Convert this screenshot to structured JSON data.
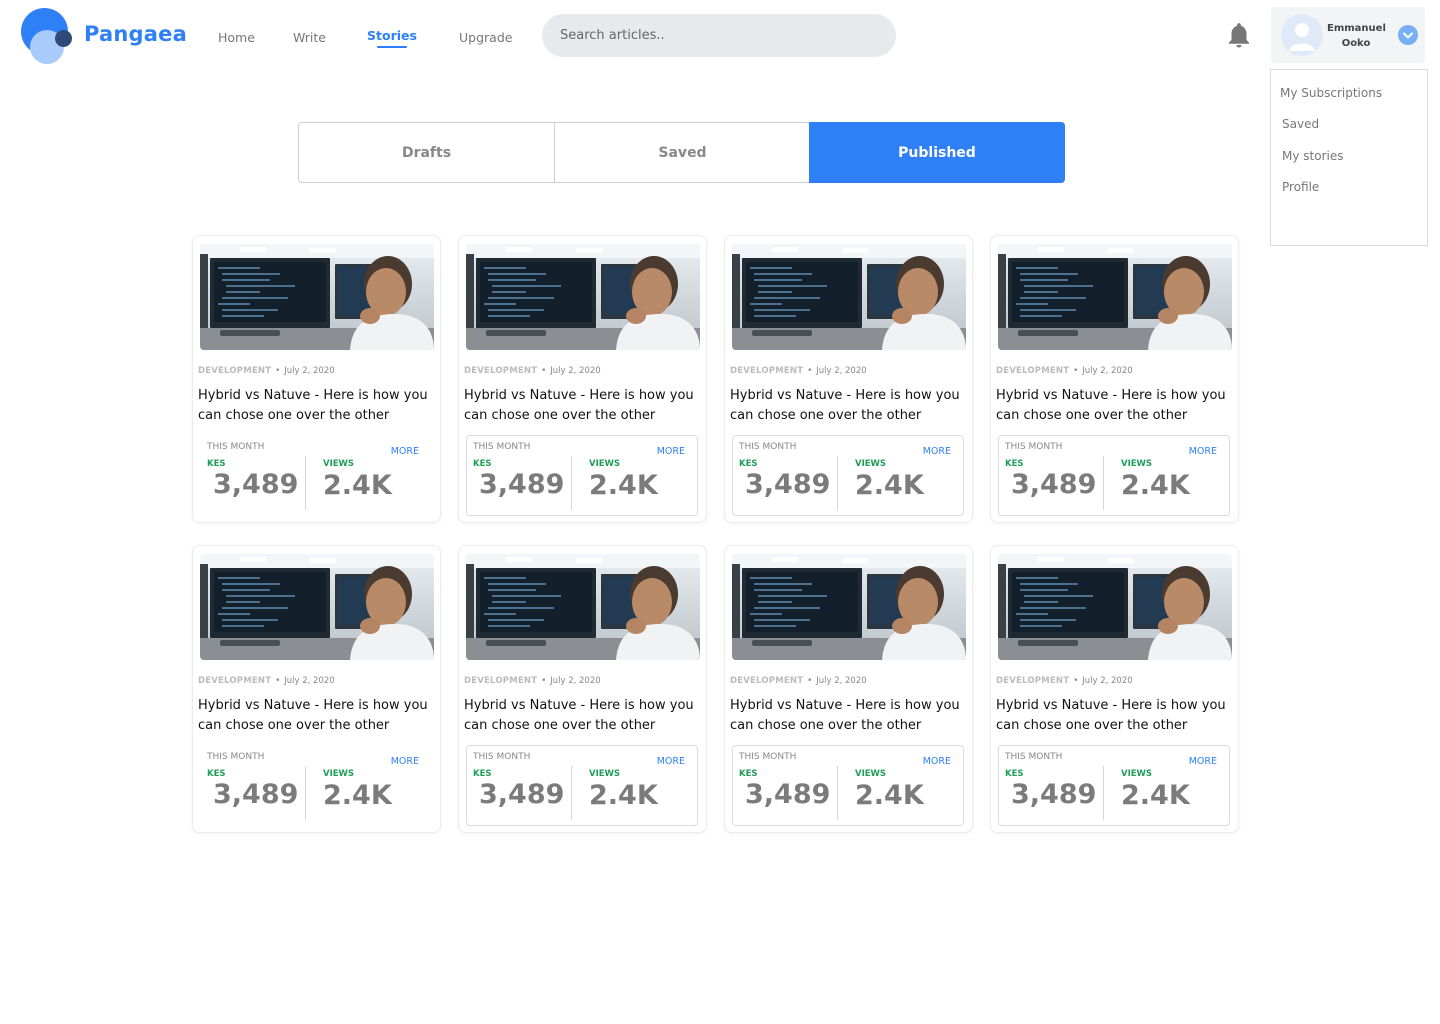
{
  "brand": {
    "name": "Pangaea"
  },
  "nav": [
    {
      "label": "Home"
    },
    {
      "label": "Write"
    },
    {
      "label": "Stories"
    },
    {
      "label": "Upgrade"
    }
  ],
  "search": {
    "placeholder": "Search articles.."
  },
  "user": {
    "first": "Emmanuel",
    "last": "Ooko"
  },
  "menu": [
    "My Subscriptions",
    "Saved",
    "My stories",
    "Profile"
  ],
  "tabs": [
    "Drafts",
    "Saved",
    "Published"
  ],
  "active_tab": "Published",
  "colors": {
    "accent": "#2f80f7",
    "positive": "#1e9e57"
  },
  "icons": {
    "notifications": "bell-icon",
    "dropdown": "chevron-down-icon",
    "avatar": "user-avatar-icon"
  },
  "cards": [
    {
      "category": "DEVELOPMENT",
      "date": "July 2, 2020",
      "title": "Hybrid vs Natuve - Here is how you can chose one over the other",
      "period": "THIS MONTH",
      "more": "MORE",
      "earnings_label": "KES",
      "earnings": "3,489",
      "views_label": "VIEWS",
      "views": "2.4K"
    },
    {
      "category": "DEVELOPMENT",
      "date": "July 2, 2020",
      "title": "Hybrid vs Natuve - Here is how you can chose one over the other",
      "period": "THIS MONTH",
      "more": "MORE",
      "earnings_label": "KES",
      "earnings": "3,489",
      "views_label": "VIEWS",
      "views": "2.4K"
    },
    {
      "category": "DEVELOPMENT",
      "date": "July 2, 2020",
      "title": "Hybrid vs Natuve - Here is how you can chose one over the other",
      "period": "THIS MONTH",
      "more": "MORE",
      "earnings_label": "KES",
      "earnings": "3,489",
      "views_label": "VIEWS",
      "views": "2.4K"
    },
    {
      "category": "DEVELOPMENT",
      "date": "July 2, 2020",
      "title": "Hybrid vs Natuve - Here is how you can chose one over the other",
      "period": "THIS MONTH",
      "more": "MORE",
      "earnings_label": "KES",
      "earnings": "3,489",
      "views_label": "VIEWS",
      "views": "2.4K"
    },
    {
      "category": "DEVELOPMENT",
      "date": "July 2, 2020",
      "title": "Hybrid vs Natuve - Here is how you can chose one over the other",
      "period": "THIS MONTH",
      "more": "MORE",
      "earnings_label": "KES",
      "earnings": "3,489",
      "views_label": "VIEWS",
      "views": "2.4K"
    },
    {
      "category": "DEVELOPMENT",
      "date": "July 2, 2020",
      "title": "Hybrid vs Natuve - Here is how you can chose one over the other",
      "period": "THIS MONTH",
      "more": "MORE",
      "earnings_label": "KES",
      "earnings": "3,489",
      "views_label": "VIEWS",
      "views": "2.4K"
    },
    {
      "category": "DEVELOPMENT",
      "date": "July 2, 2020",
      "title": "Hybrid vs Natuve - Here is how you can chose one over the other",
      "period": "THIS MONTH",
      "more": "MORE",
      "earnings_label": "KES",
      "earnings": "3,489",
      "views_label": "VIEWS",
      "views": "2.4K"
    },
    {
      "category": "DEVELOPMENT",
      "date": "July 2, 2020",
      "title": "Hybrid vs Natuve - Here is how you can chose one over the other",
      "period": "THIS MONTH",
      "more": "MORE",
      "earnings_label": "KES",
      "earnings": "3,489",
      "views_label": "VIEWS",
      "views": "2.4K"
    }
  ]
}
